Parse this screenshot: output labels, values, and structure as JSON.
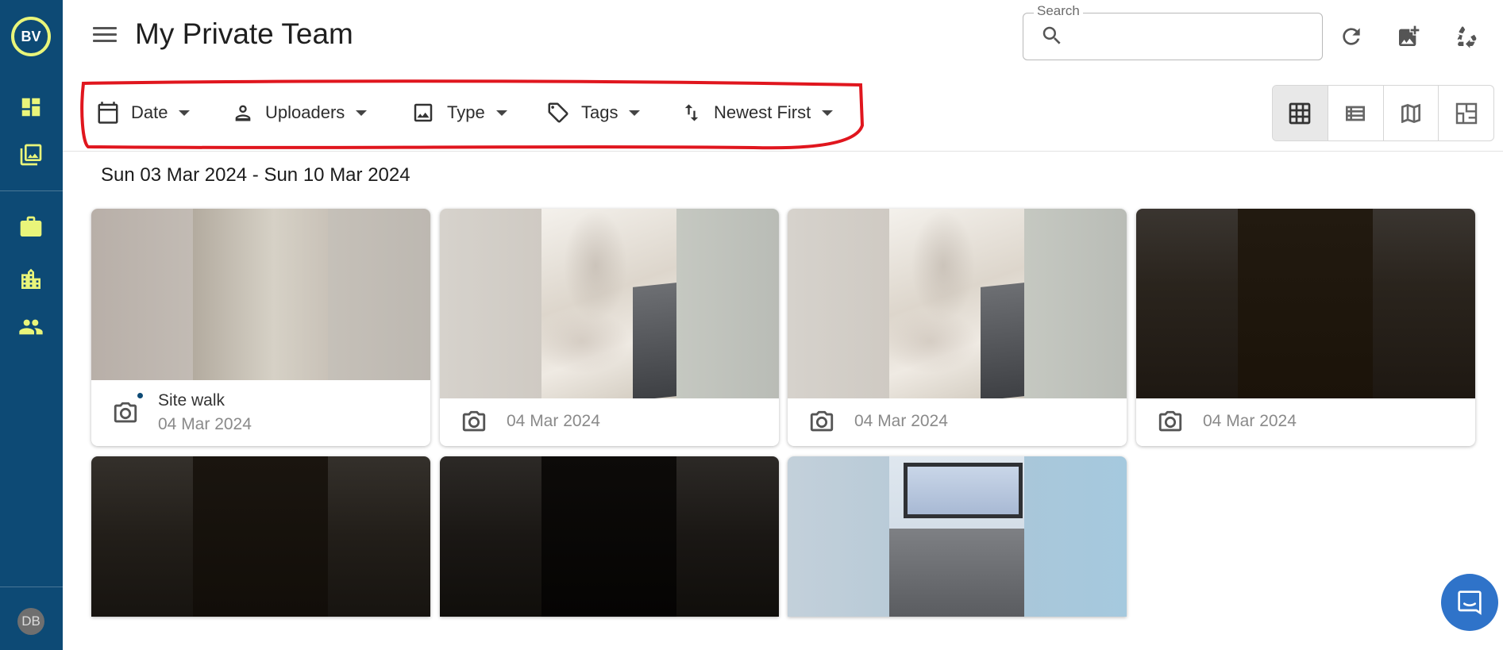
{
  "sidebar": {
    "logo_text": "BV",
    "avatar_initials": "DB",
    "nav_icons": [
      "dashboard-icon",
      "photo-library-icon",
      "briefcase-icon",
      "buildings-icon",
      "people-icon"
    ],
    "accent_color": "#e9f57a",
    "bg_color": "#0d4a75"
  },
  "header": {
    "title": "My Private Team",
    "search": {
      "label": "Search",
      "placeholder": "",
      "value": ""
    },
    "actions": [
      "refresh-icon",
      "add-photo-icon",
      "recycle-icon"
    ]
  },
  "filters": [
    {
      "label": "Date",
      "icon": "calendar-icon"
    },
    {
      "label": "Uploaders",
      "icon": "person-icon"
    },
    {
      "label": "Type",
      "icon": "image-icon"
    },
    {
      "label": "Tags",
      "icon": "tag-icon"
    },
    {
      "label": "Newest First",
      "icon": "sort-icon"
    }
  ],
  "view_modes": [
    {
      "name": "grid-view",
      "active": true
    },
    {
      "name": "list-view",
      "active": false
    },
    {
      "name": "map-view",
      "active": false
    },
    {
      "name": "floorplan-view",
      "active": false
    }
  ],
  "date_range": "Sun 03 Mar 2024 - Sun 10 Mar 2024",
  "cards": [
    {
      "title": "Site walk",
      "date": "04 Mar 2024",
      "unread": true
    },
    {
      "title": "",
      "date": "04 Mar 2024",
      "unread": false
    },
    {
      "title": "",
      "date": "04 Mar 2024",
      "unread": false
    },
    {
      "title": "",
      "date": "04 Mar 2024",
      "unread": false
    }
  ],
  "annotation_color": "#e0161e"
}
